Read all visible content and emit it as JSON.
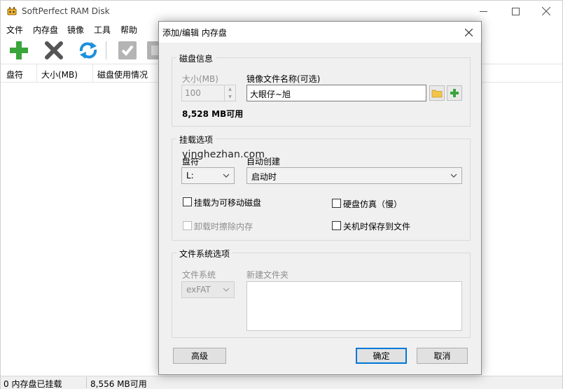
{
  "app": {
    "title": "SoftPerfect RAM Disk",
    "window_controls": [
      "minimize",
      "maximize",
      "close"
    ]
  },
  "menu": [
    "文件",
    "内存盘",
    "镜像",
    "工具",
    "帮助"
  ],
  "toolbar": {
    "buttons": [
      {
        "icon": "plus-icon",
        "color": "#3aa53a"
      },
      {
        "icon": "x-icon",
        "color": "#555555"
      },
      {
        "icon": "refresh-icon",
        "color": "#1e8fdc"
      },
      {
        "icon": "check-icon",
        "color": "#a8a8a8"
      },
      {
        "icon": "box-icon",
        "color": "#a8a8a8"
      }
    ]
  },
  "list": {
    "columns": [
      "盘符",
      "大小(MB)",
      "磁盘使用情况"
    ]
  },
  "status": {
    "mounted": "0 内存盘已挂载",
    "free": "8,556 MB可用"
  },
  "dialog": {
    "title": "添加/编辑 内存盘",
    "disk_info": {
      "group_label": "磁盘信息",
      "size_label": "大小(MB)",
      "size_value": "100",
      "image_label": "镜像文件名称(可选)",
      "image_value": "大眼仔~旭",
      "available": "8,528 MB可用"
    },
    "mount": {
      "group_label": "挂载选项",
      "drive_label": "盘符",
      "drive_value": "L:",
      "autocreate_label": "自动创建",
      "autocreate_value": "启动时",
      "removable": "挂载为可移动磁盘",
      "hdd_emulation": "硬盘仿真（慢）",
      "wipe_on_unmount": "卸载时擦除内存",
      "save_on_shutdown": "关机时保存到文件"
    },
    "fs": {
      "group_label": "文件系统选项",
      "fs_label": "文件系统",
      "fs_value": "exFAT",
      "folders_label": "新建文件夹"
    },
    "buttons": {
      "advanced": "高级",
      "ok": "确定",
      "cancel": "取消"
    }
  },
  "watermark": "yinghezhan.com",
  "colors": {
    "accent": "#0078d7",
    "green": "#3aa53a"
  }
}
